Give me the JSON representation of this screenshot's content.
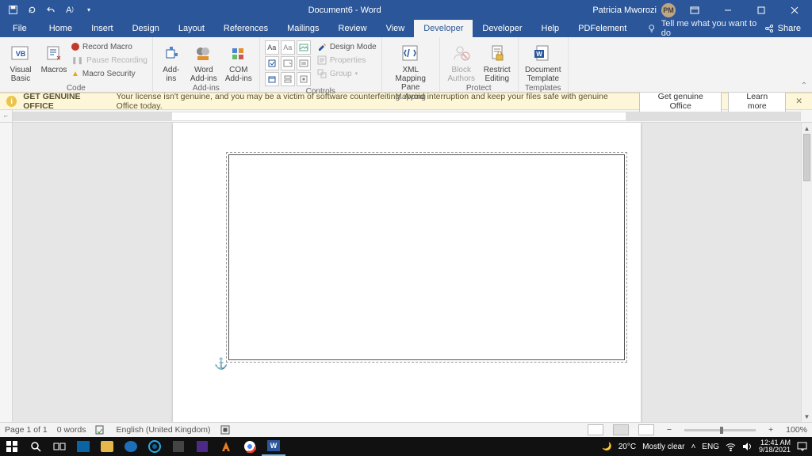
{
  "title": {
    "doc": "Document6 - Word",
    "user": "Patricia Mworozi",
    "initials": "PM"
  },
  "tabs": {
    "file": "File",
    "list": [
      "Home",
      "Insert",
      "Design",
      "Layout",
      "References",
      "Mailings",
      "Review",
      "View",
      "Developer",
      "Developer",
      "Help",
      "PDFelement"
    ],
    "active_index": 8,
    "tell_me": "Tell me what you want to do",
    "share": "Share"
  },
  "ribbon": {
    "code": {
      "visual_basic": "Visual\nBasic",
      "macros": "Macros",
      "record": "Record Macro",
      "pause": "Pause Recording",
      "security": "Macro Security",
      "label": "Code"
    },
    "addins": {
      "addins": "Add-\nins",
      "word": "Word\nAdd-ins",
      "com": "COM\nAdd-ins",
      "label": "Add-ins"
    },
    "controls": {
      "design": "Design Mode",
      "properties": "Properties",
      "group": "Group",
      "label": "Controls"
    },
    "mapping": {
      "xml": "XML Mapping\nPane",
      "label": "Mapping"
    },
    "protect": {
      "block": "Block\nAuthors",
      "restrict": "Restrict\nEditing",
      "label": "Protect"
    },
    "templates": {
      "doc": "Document\nTemplate",
      "label": "Templates"
    }
  },
  "banner": {
    "strong": "GET GENUINE OFFICE",
    "text": "Your license isn't genuine, and you may be a victim of software counterfeiting. Avoid interruption and keep your files safe with genuine Office today.",
    "btn1": "Get genuine Office",
    "btn2": "Learn more"
  },
  "status": {
    "page": "Page 1 of 1",
    "words": "0 words",
    "lang": "English (United Kingdom)",
    "zoom": "100%"
  },
  "taskbar": {
    "weather_temp": "20°C",
    "weather_cond": "Mostly clear",
    "lang": "ENG",
    "time": "12:41 AM",
    "date": "9/18/2021"
  }
}
